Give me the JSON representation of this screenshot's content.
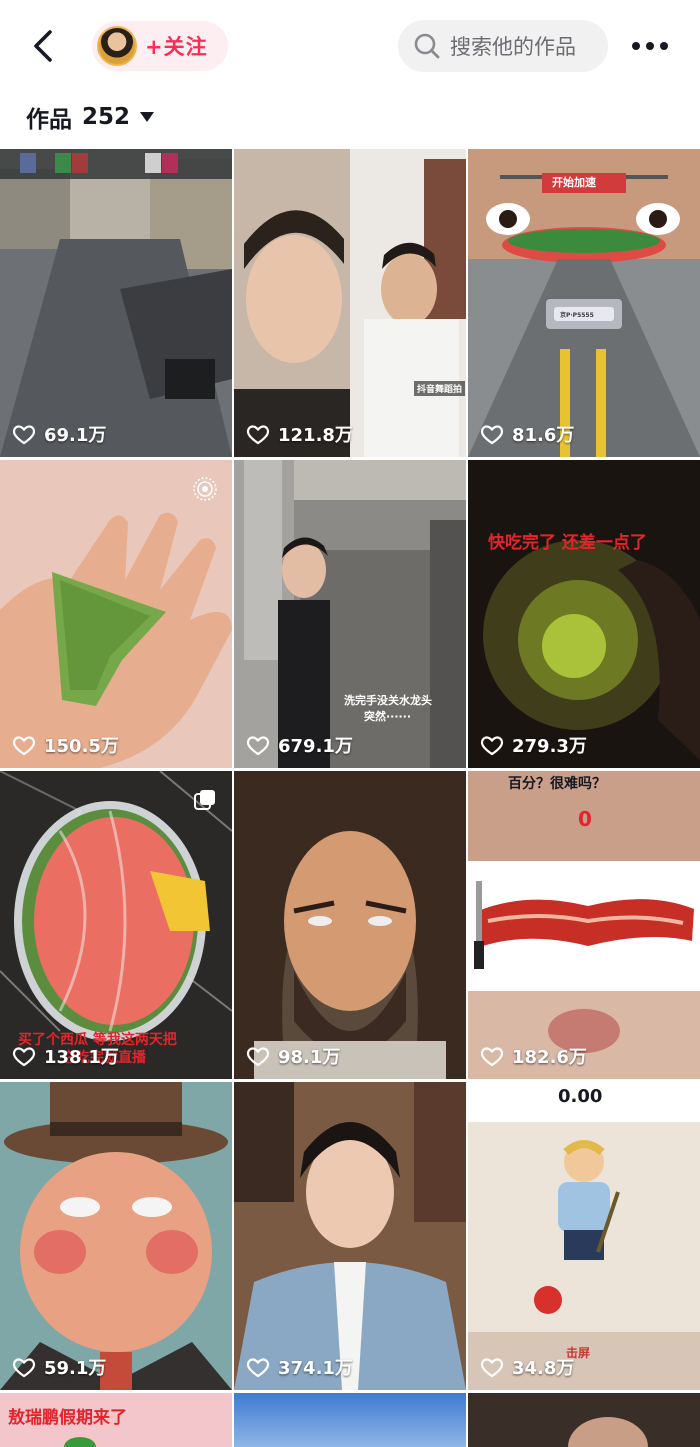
{
  "header": {
    "follow_label": "+关注",
    "search_placeholder": "搜索他的作品"
  },
  "works": {
    "label": "作品",
    "count": "252"
  },
  "tiles": [
    {
      "likes": "69.1万"
    },
    {
      "likes": "121.8万",
      "caption": "抖音舞蹈拍"
    },
    {
      "likes": "81.6万",
      "banner": "开始加速",
      "plate": "京P·P5555"
    },
    {
      "likes": "150.5万"
    },
    {
      "likes": "679.1万",
      "caption_line1": "洗完手没关水龙头",
      "caption_line2": "突然······"
    },
    {
      "likes": "279.3万",
      "title": "快吃完了 还差一点了"
    },
    {
      "likes": "138.1万",
      "caption_line1": "买了个西瓜 等我这两天把",
      "caption_line2": "它吃完就直播"
    },
    {
      "likes": "98.1万"
    },
    {
      "likes": "182.6万",
      "top_text": "百分？很难吗？",
      "score": "0"
    },
    {
      "likes": "59.1万"
    },
    {
      "likes": "374.1万"
    },
    {
      "likes": "34.8万",
      "timer": "0.00",
      "bottom_text": "击屏"
    },
    {
      "likes": "",
      "title": "敖瑞鹏假期来了"
    },
    {
      "likes": ""
    },
    {
      "likes": ""
    }
  ],
  "colors": {
    "accent": "#fe2c55",
    "follow_bg": "#fdeef1",
    "search_bg": "#f1f1f2"
  }
}
